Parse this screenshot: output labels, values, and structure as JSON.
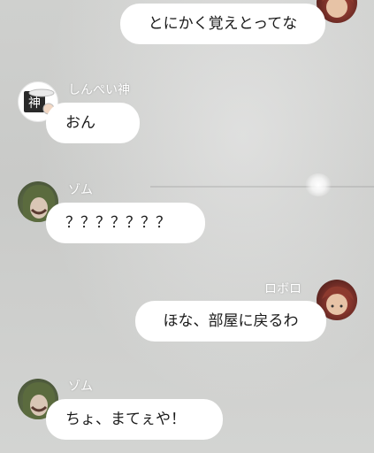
{
  "messages": [
    {
      "sender": "",
      "text": "とにかく覚えとってな",
      "side": "right"
    },
    {
      "sender": "しんぺい神",
      "text": "おん",
      "side": "left",
      "avatar_icon": "shinpei-avatar"
    },
    {
      "sender": "ゾム",
      "text": "？？？？？？？",
      "side": "left",
      "avatar_icon": "zom-avatar"
    },
    {
      "sender": "ロボロ",
      "text": "ほな、部屋に戻るわ",
      "side": "right",
      "avatar_icon": "robolo-avatar"
    },
    {
      "sender": "ゾム",
      "text": "ちょ、まてぇや！",
      "side": "left",
      "avatar_icon": "zom-avatar"
    }
  ],
  "colors": {
    "bubble": "#ffffff",
    "text": "#1a1a1a",
    "sender_name": "#ffffff"
  }
}
